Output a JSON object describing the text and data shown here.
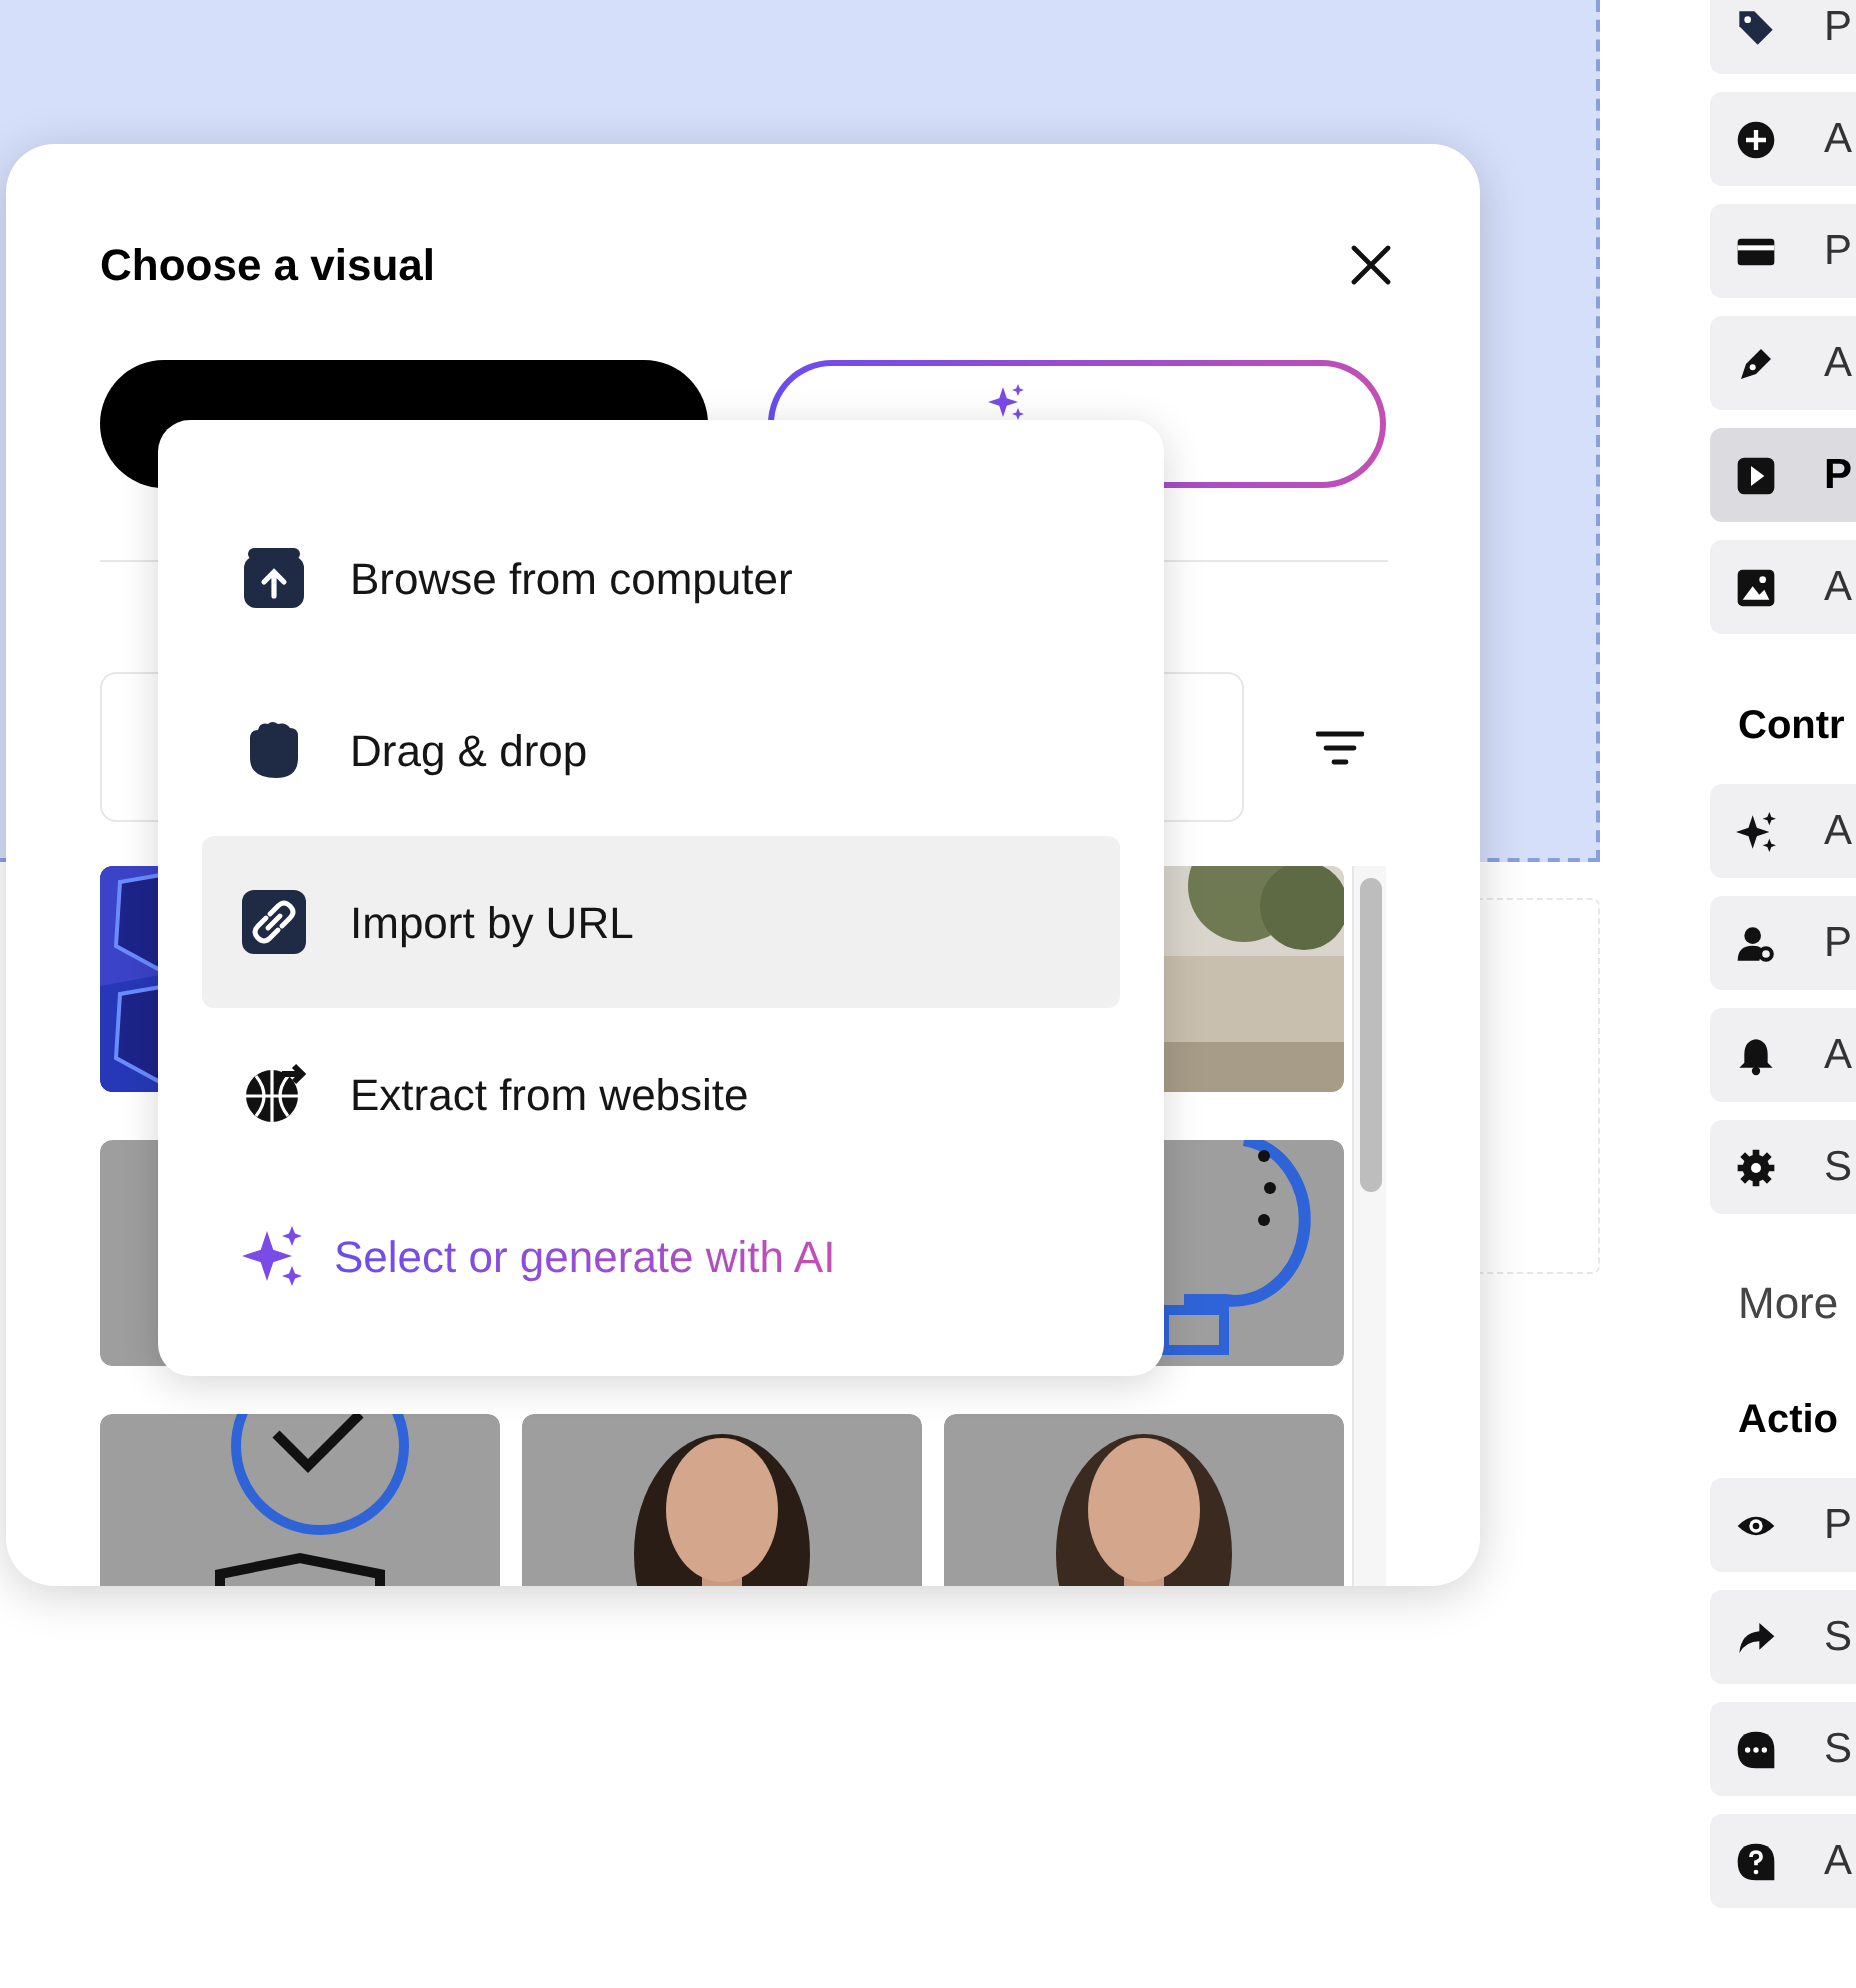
{
  "dialog": {
    "title": "Choose a visual",
    "tabs": [
      {
        "selected": true,
        "kind": "plain"
      },
      {
        "selected": false,
        "kind": "ai"
      }
    ]
  },
  "menu": {
    "items": [
      {
        "label": "Browse from computer",
        "kind": "plain",
        "highlighted": false
      },
      {
        "label": "Drag & drop",
        "kind": "plain",
        "highlighted": false
      },
      {
        "label": "Import by URL",
        "kind": "plain",
        "highlighted": true
      },
      {
        "label": "Extract from website",
        "kind": "plain",
        "highlighted": false
      },
      {
        "label": "Select or generate with AI",
        "kind": "ai",
        "highlighted": false
      }
    ]
  },
  "sidebar": {
    "groups": [
      {
        "items": [
          {
            "label": "P",
            "selected": false
          },
          {
            "label": "A",
            "selected": false
          },
          {
            "label": "P",
            "selected": false
          },
          {
            "label": "A",
            "selected": false
          },
          {
            "label": "P",
            "selected": true
          },
          {
            "label": "A",
            "selected": false
          }
        ]
      },
      {
        "heading": "Contr",
        "items": [
          {
            "label": "A",
            "selected": false
          },
          {
            "label": "P",
            "selected": false
          },
          {
            "label": "A",
            "selected": false
          },
          {
            "label": "S",
            "selected": false
          }
        ]
      },
      {
        "link": "More"
      },
      {
        "heading": "Actio",
        "items": [
          {
            "label": "P",
            "selected": false
          },
          {
            "label": "S",
            "selected": false
          },
          {
            "label": "S",
            "selected": false
          },
          {
            "label": "A",
            "selected": false
          }
        ]
      }
    ]
  }
}
